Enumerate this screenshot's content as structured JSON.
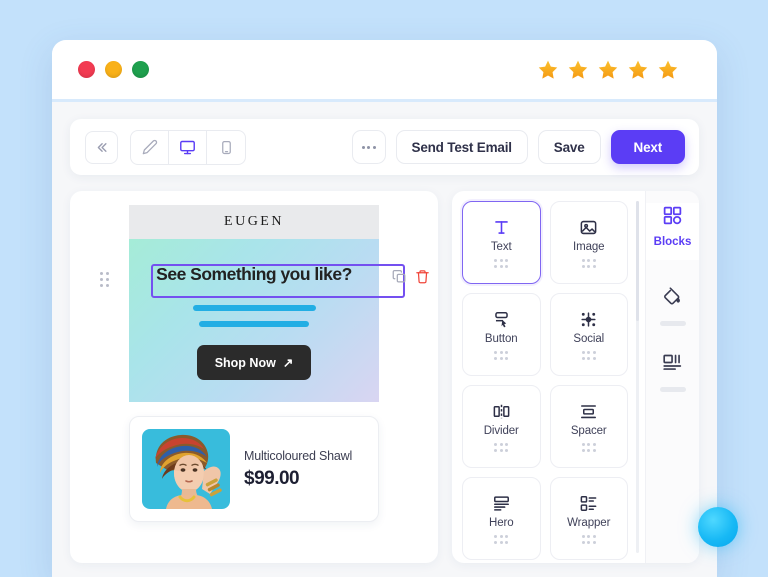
{
  "window": {
    "traffic_lights": [
      "close",
      "minimize",
      "maximize"
    ],
    "rating_stars": 5,
    "star_color": "#f5a623"
  },
  "toolbar": {
    "collapse_label": "«",
    "devices": [
      {
        "name": "edit",
        "icon": "pencil-icon",
        "active": false
      },
      {
        "name": "desktop",
        "icon": "desktop-icon",
        "active": true
      },
      {
        "name": "mobile",
        "icon": "mobile-icon",
        "active": false
      }
    ],
    "more_label": "...",
    "send_test_email_label": "Send Test Email",
    "save_label": "Save",
    "next_label": "Next",
    "primary_color": "#5b3df5"
  },
  "canvas": {
    "logo": "EUGEN",
    "hero": {
      "headline": "See Something you like?",
      "cta_label": "Shop Now",
      "cta_arrow": "↗",
      "gradient_from": "#a5ecd7",
      "gradient_to": "#d9d5f2"
    },
    "selection": {
      "block_type": "text",
      "outline_color": "#7450f0",
      "duplicate_icon": "duplicate-icon",
      "delete_icon": "trash-icon",
      "delete_color": "#f0453a"
    },
    "product": {
      "name": "Multicoloured Shawl",
      "price": "$99.00",
      "image_alt": "woman wearing multicoloured turban"
    }
  },
  "blocks_panel": {
    "items": [
      {
        "label": "Text",
        "icon": "text-icon",
        "selected": true
      },
      {
        "label": "Image",
        "icon": "image-icon",
        "selected": false
      },
      {
        "label": "Button",
        "icon": "button-icon",
        "selected": false
      },
      {
        "label": "Social",
        "icon": "social-icon",
        "selected": false
      },
      {
        "label": "Divider",
        "icon": "divider-icon",
        "selected": false
      },
      {
        "label": "Spacer",
        "icon": "spacer-icon",
        "selected": false
      },
      {
        "label": "Hero",
        "icon": "hero-icon",
        "selected": false
      },
      {
        "label": "Wrapper",
        "icon": "wrapper-icon",
        "selected": false
      }
    ]
  },
  "rail": {
    "active_label": "Blocks",
    "active_color": "#5b3df5",
    "items": [
      {
        "name": "blocks",
        "icon": "grid-icon",
        "label": "Blocks"
      },
      {
        "name": "theme",
        "icon": "paint-bucket-icon",
        "label": ""
      },
      {
        "name": "layout",
        "icon": "layout-icon",
        "label": ""
      }
    ]
  },
  "chat": {
    "name": "chat-bubble",
    "color": "#18b9f5"
  }
}
